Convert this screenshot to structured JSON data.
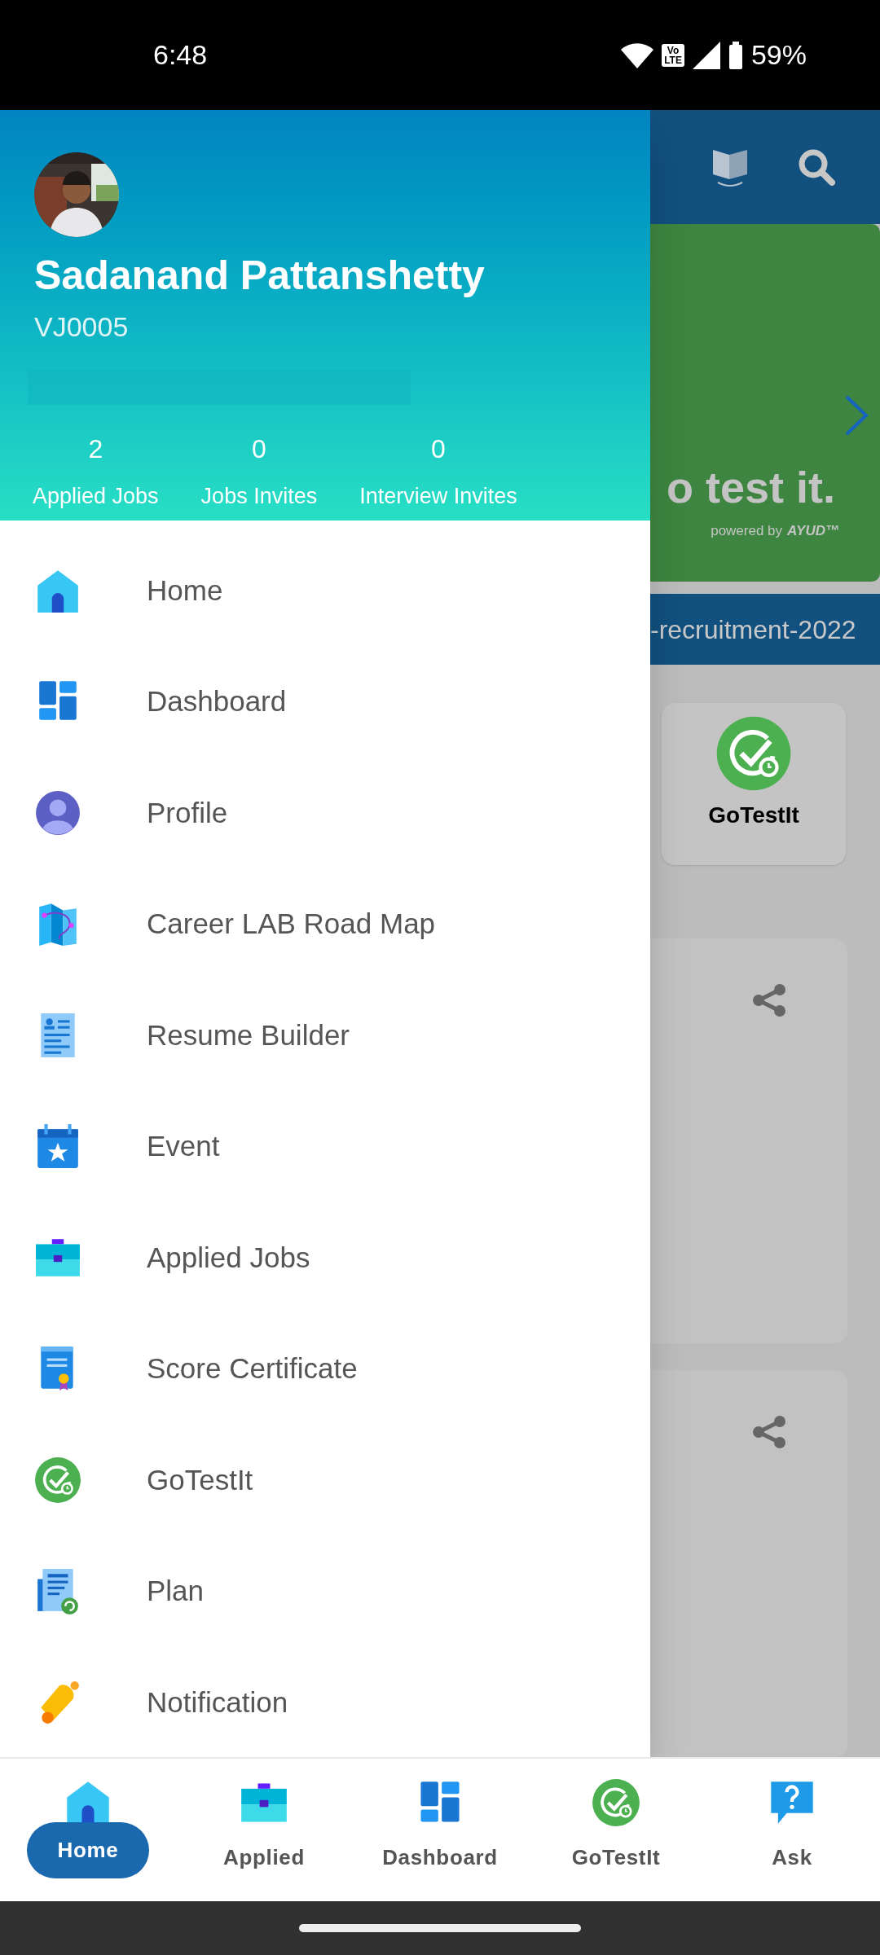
{
  "status_bar": {
    "time": "6:48",
    "volte": [
      "Vo",
      "LTE"
    ],
    "battery": "59%"
  },
  "drawer": {
    "profile": {
      "name": "Sadanand Pattanshetty",
      "id": "VJ0005"
    },
    "stats": [
      {
        "value": "2",
        "label": "Applied Jobs"
      },
      {
        "value": "0",
        "label": "Jobs Invites"
      },
      {
        "value": "0",
        "label": "Interview Invites"
      }
    ],
    "menu": [
      {
        "label": "Home",
        "kind": "home"
      },
      {
        "label": "Dashboard",
        "kind": "dashboard"
      },
      {
        "label": "Profile",
        "kind": "profile"
      },
      {
        "label": "Career LAB Road Map",
        "kind": "map"
      },
      {
        "label": "Resume Builder",
        "kind": "resume"
      },
      {
        "label": "Event",
        "kind": "event"
      },
      {
        "label": "Applied Jobs",
        "kind": "briefcase"
      },
      {
        "label": "Score Certificate",
        "kind": "certificate"
      },
      {
        "label": "GoTestIt",
        "kind": "gotestit"
      },
      {
        "label": "Plan",
        "kind": "plan"
      },
      {
        "label": "Notification",
        "kind": "bell"
      }
    ]
  },
  "background": {
    "banner_text": "o test it.",
    "powered_by": "powered by",
    "brand": "AYUD™",
    "strip_text": "-recruitment-2022",
    "tile_label": "GoTestIt"
  },
  "bottom_nav": [
    {
      "label": "Home",
      "kind": "home",
      "selected": true
    },
    {
      "label": "Applied",
      "kind": "briefcase",
      "selected": false
    },
    {
      "label": "Dashboard",
      "kind": "dashboard",
      "selected": false
    },
    {
      "label": "GoTestIt",
      "kind": "gotestit",
      "selected": false
    },
    {
      "label": "Ask",
      "kind": "ask",
      "selected": false
    }
  ]
}
